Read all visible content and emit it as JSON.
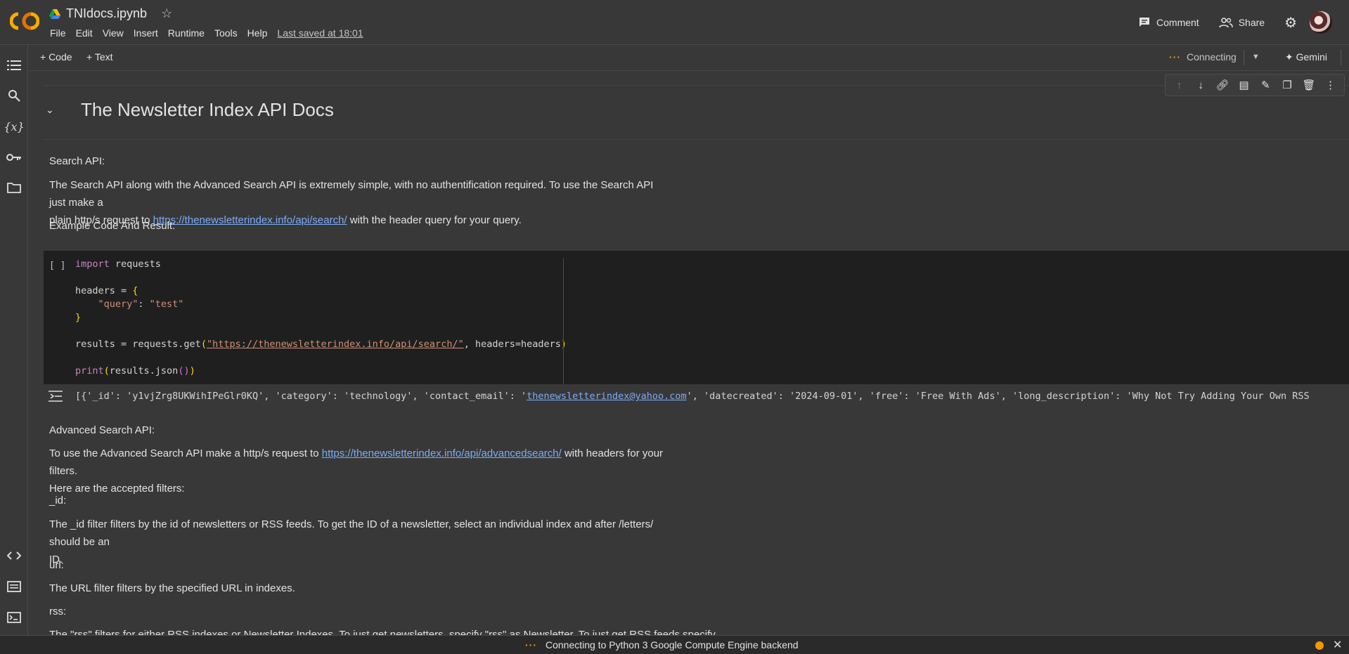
{
  "app": {
    "logo_text": "CO",
    "doc_title": "TNIdocs.ipynb",
    "menu": [
      "File",
      "Edit",
      "View",
      "Insert",
      "Runtime",
      "Tools",
      "Help"
    ],
    "last_saved": "Last saved at 18:01",
    "comment_label": "Comment",
    "share_label": "Share"
  },
  "toolbar": {
    "add_code": "+ Code",
    "add_text": "+ Text",
    "connection_status": "Connecting",
    "gemini_label": "✦ Gemini"
  },
  "notebook": {
    "heading": "The Newsletter Index API Docs",
    "search_api_label": "Search API:",
    "search_api_desc_1": "The Search API along with the Advanced Search API is extremely simple, with no authentification required. To use the Search API just make a",
    "search_api_desc_2_pre": "plain http/s request to ",
    "search_api_link": "https://thenewsletterindex.info/api/search/",
    "search_api_desc_2_post": " with the header query for your query.",
    "example_label": "Example Code And Result:",
    "run_bracket": "[ ]",
    "code": {
      "l1_kw": "import",
      "l1_rest": " requests",
      "l3_a": "headers = ",
      "l3_b": "{",
      "l4_key": "    \"query\"",
      "l4_sep": ": ",
      "l4_val": "\"test\"",
      "l5": "}",
      "l7_a": "results = requests.get",
      "l7_b": "(",
      "l7_url": "\"https://thenewsletterindex.info/api/search/\"",
      "l7_c": ", headers=headers",
      "l7_d": ")",
      "l9_a": "print",
      "l9_b": "(",
      "l9_c": "results.json",
      "l9_d": "()",
      "l9_e": ")"
    },
    "output_pre": "[{'_id': 'y1vjZrg8UKWihIPeGlr0KQ', 'category': 'technology', 'contact_email': '",
    "output_email": "thenewsletterindex@yahoo.com",
    "output_post": "', 'datecreated': '2024-09-01', 'free': 'Free With Ads', 'long_description': 'Why Not Try Adding Your Own RSS",
    "adv_label": "Advanced Search API:",
    "adv_desc_pre": "To use the Advanced Search API make a http/s request to ",
    "adv_link": "https://thenewsletterindex.info/api/advancedsearch/",
    "adv_desc_post": " with headers for your filters.",
    "adv_filters": "Here are the accepted filters:",
    "id_label": "_id:",
    "id_desc_1": "The _id filter filters by the id of newsletters or RSS feeds. To get the ID of a newsletter, select an individual index and after /letters/ should be an",
    "id_desc_2": "ID.",
    "url_label": "url:",
    "url_desc": "The URL filter filters by the specified URL in indexes.",
    "rss_label": "rss:",
    "rss_desc": "The \"rss\" filters for either RSS indexes or Newsletter Indexes. To just get newsletters, specify \"rss\" as Newsletter. To just get RSS feeds specify"
  },
  "status": {
    "text": "Connecting to Python 3 Google Compute Engine backend"
  }
}
